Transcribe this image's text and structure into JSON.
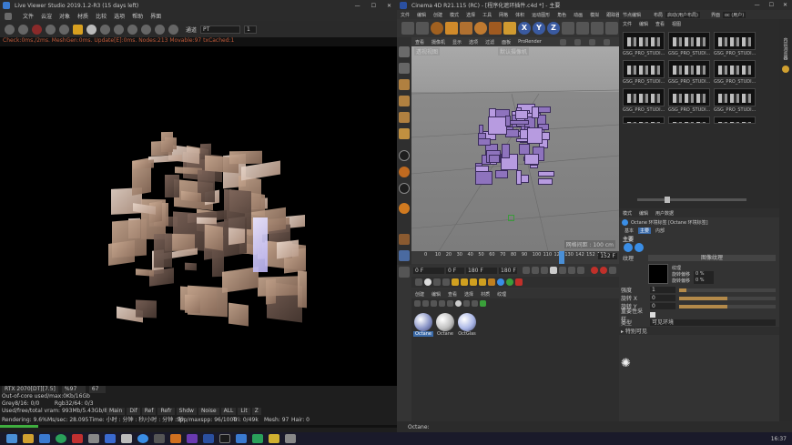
{
  "live_viewer": {
    "title": "Live Viewer Studio 2019.1.2-R3 (15 days left)",
    "menu": [
      "文件",
      "云渲",
      "对象",
      "材质",
      "比较",
      "选项",
      "帮助",
      "界面"
    ],
    "toolbar": {
      "channel_label": "通道",
      "channel_value": "PT",
      "count_value": "1"
    },
    "status_text": "Check:0ms./2ms. MeshGen:0ms. Update[E]:0ms. Nodes:213 Movable:97 txCached:1",
    "info": {
      "gpu": "RTX 2070[DT][7.5]",
      "gpu_pct": "%97",
      "gpu_val": "67",
      "out_of_core": "Out-of-core used/max:0Kb/16Gb",
      "grey": "Grey8/16: 0/0",
      "rgb": "Rgb32/64: 0/3",
      "vram": "Used/free/total vram: 993Mb/5.43Gb/8Gb",
      "tabs": [
        "Main",
        "Dif",
        "Ref",
        "Refr",
        "Shdw",
        "Noise",
        "ALL",
        "Lit",
        "Z"
      ],
      "rendering": "Rendering: 9.6%",
      "mssec": "Ms/sec: 28.095",
      "time": "Time: 小时 : 分钟 : 秒/小时 : 分钟 : 秒",
      "spp": "Spp/maxspp: 96/1000",
      "tri": "Tri: 0/49k",
      "mesh": "Mesh: 97",
      "hair": "Hair: 0"
    }
  },
  "c4d": {
    "title": "Cinema 4D R21.115 (RC) - [程序化遮环插件.c4d *] - 主要",
    "menu": [
      "文件",
      "编辑",
      "创建",
      "模式",
      "选择",
      "工具",
      "网格",
      "体积",
      "运动图形",
      "角色",
      "动画",
      "模拟",
      "跟踪器",
      "渲染",
      "扩展",
      "窗口",
      "帮助"
    ],
    "toolbar_letters": [
      "X",
      "Y",
      "Z"
    ],
    "viewport_menu": [
      "查看",
      "摄像机",
      "显示",
      "选项",
      "过滤",
      "面板",
      "ProRender"
    ],
    "viewport_label": "透视视图",
    "camera_label": "默认摄像机",
    "grid_label": "网格间距 : 100 cm",
    "timeline_ticks": [
      "0",
      "10",
      "20",
      "30",
      "40",
      "50",
      "60",
      "70",
      "80",
      "90",
      "100",
      "110",
      "120",
      "130",
      "142",
      "152",
      "160"
    ],
    "frame_start": "0 F",
    "frame_current": "0 F",
    "frame_end": "180 F",
    "frame_display": "180 F",
    "frame_right": "152 F",
    "mat_menu": [
      "创建",
      "编辑",
      "查看",
      "选择",
      "材质",
      "纹理"
    ],
    "materials": [
      {
        "name": "Octane",
        "kind": "blue"
      },
      {
        "name": "Octane",
        "kind": "white"
      },
      {
        "name": "OctGlas",
        "kind": "gloss"
      }
    ],
    "status_text": "Octane:",
    "right_head": [
      "节点编辑",
      "布局",
      "启动(用户布局)",
      "界面",
      "oc (用户)"
    ],
    "browser_tabs": [
      "文件",
      "编辑",
      "查看",
      "视图"
    ],
    "thumb_labels": [
      "GSG_PRO_STUDI...",
      "GSG_PRO_STUDI...",
      "GSG_PRO_STUDI...",
      "GSG_PRO_STUDI...",
      "GSG_PRO_STUDI...",
      "GSG_PRO_STUDI...",
      "GSG_PRO_STUDI...",
      "GSG_PRO_STUDI...",
      "GSG_PRO_STUDI..."
    ],
    "attr": {
      "menu": [
        "模式",
        "编辑",
        "用户数据"
      ],
      "title": "Octane 环境标签 [Octane 环境标签]",
      "tabs": [
        "基本",
        "主要",
        "内部"
      ],
      "section": "主要",
      "texture_label": "纹理",
      "texture_button": "图像纹理",
      "power_label": "强度",
      "power_value": "1",
      "rot_x_label": "旋转 X",
      "rot_x_value": "0",
      "rot_y_label": "旋转 Y",
      "rot_y_value": "0",
      "importance_label": "重要性采样",
      "type_label": "类型",
      "type_value": "可见环境",
      "sub_fields": [
        {
          "label": "纹理",
          "value": ""
        },
        {
          "label": "旋转偏移",
          "value": "0 %"
        },
        {
          "label": "旋转偏移",
          "value": "0 %"
        }
      ],
      "collapse_label": "▸ 特别可见"
    },
    "sidebar_label": "内容浏览器"
  },
  "taskbar": {
    "clock": "16:37"
  },
  "colors": {
    "accent": "#d08a2a",
    "timeline_marker": "#4a8fd6",
    "octane_blue": "#3a8ee6"
  }
}
